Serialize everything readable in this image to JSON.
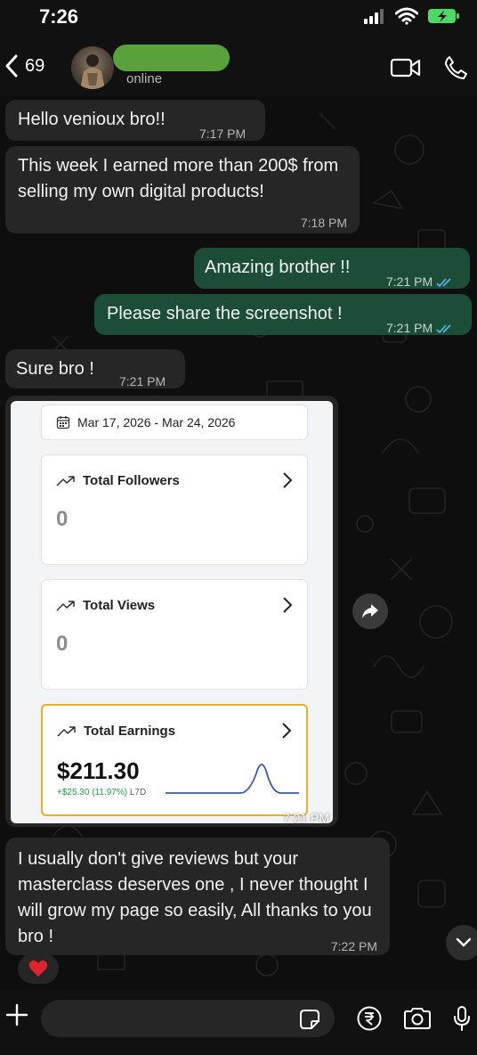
{
  "status_bar": {
    "time": "7:26"
  },
  "header": {
    "back_count": "69",
    "contact_status": "online"
  },
  "messages": [
    {
      "text": "Hello venioux bro!!",
      "time": "7:17 PM"
    },
    {
      "text": "This week I earned more than 200$ from selling my own digital products!",
      "time": "7:18 PM"
    },
    {
      "text": "Amazing brother !!",
      "time": "7:21 PM"
    },
    {
      "text": "Please share the screenshot !",
      "time": "7:21 PM"
    },
    {
      "text": "Sure bro !",
      "time": "7:21 PM"
    },
    {
      "text": "I usually don't give reviews but your masterclass deserves one , I never thought I will grow my page so easily, All thanks to you bro !",
      "time": "7:22 PM"
    }
  ],
  "screenshot": {
    "date_range": "Mar 17, 2026 - Mar 24, 2026",
    "cards": [
      {
        "title": "Total Followers",
        "value": "0"
      },
      {
        "title": "Total Views",
        "value": "0"
      },
      {
        "title": "Total Earnings",
        "value": "$211.30",
        "delta": "+$25.30 (11.97%)",
        "period": "L7D"
      }
    ],
    "time": "7:21 PM"
  },
  "reaction": {
    "emoji": "heart"
  },
  "colors": {
    "incoming_bubble": "#262626",
    "outgoing_bubble": "#1c4d38",
    "read_ticks": "#53bdeb",
    "earnings_border": "#e8b022",
    "sparkline": "#3557c4"
  }
}
